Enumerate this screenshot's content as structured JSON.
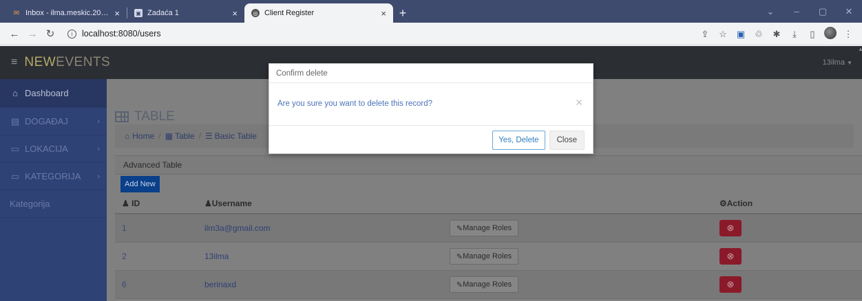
{
  "browser": {
    "tabs": [
      {
        "title": "Inbox - ilma.meskic.20@size.ba",
        "icon": "mail-icon"
      },
      {
        "title": "Zadaća 1",
        "icon": "classroom-icon"
      },
      {
        "title": "Client Register",
        "icon": "globe-icon"
      }
    ],
    "url": "localhost:8080/users"
  },
  "app": {
    "brand_primary": "NEW",
    "brand_secondary": "EVENTS",
    "user": "13ilma"
  },
  "sidebar": {
    "items": [
      {
        "label": "Dashboard",
        "icon": "home-icon"
      },
      {
        "label": "DOGAĐAJ",
        "icon": "file-icon"
      },
      {
        "label": "LOKACIJA",
        "icon": "monitor-icon"
      },
      {
        "label": "KATEGORIJA",
        "icon": "monitor-icon"
      }
    ],
    "extra": "Kategorija"
  },
  "page": {
    "title": "TABLE",
    "breadcrumb": [
      "Home",
      "Table",
      "Basic Table"
    ],
    "panel_title": "Advanced Table",
    "add_new": "Add New"
  },
  "table": {
    "headers": {
      "id": "ID",
      "username": "Username",
      "action": "Action"
    },
    "manage_label": "Manage Roles",
    "rows": [
      {
        "id": "1",
        "username": "ilm3a@gmail.com"
      },
      {
        "id": "2",
        "username": "13ilma"
      },
      {
        "id": "6",
        "username": "berinaxd"
      }
    ]
  },
  "modal": {
    "title": "Confirm delete",
    "message": "Are you sure you want to delete this record?",
    "yes_label": "Yes, Delete",
    "close_label": "Close"
  },
  "colors": {
    "navbar": "#2b2e33",
    "sidebar": "#2f4275",
    "primary_button": "#0a3f8a",
    "danger_button": "#8a1a2a"
  }
}
